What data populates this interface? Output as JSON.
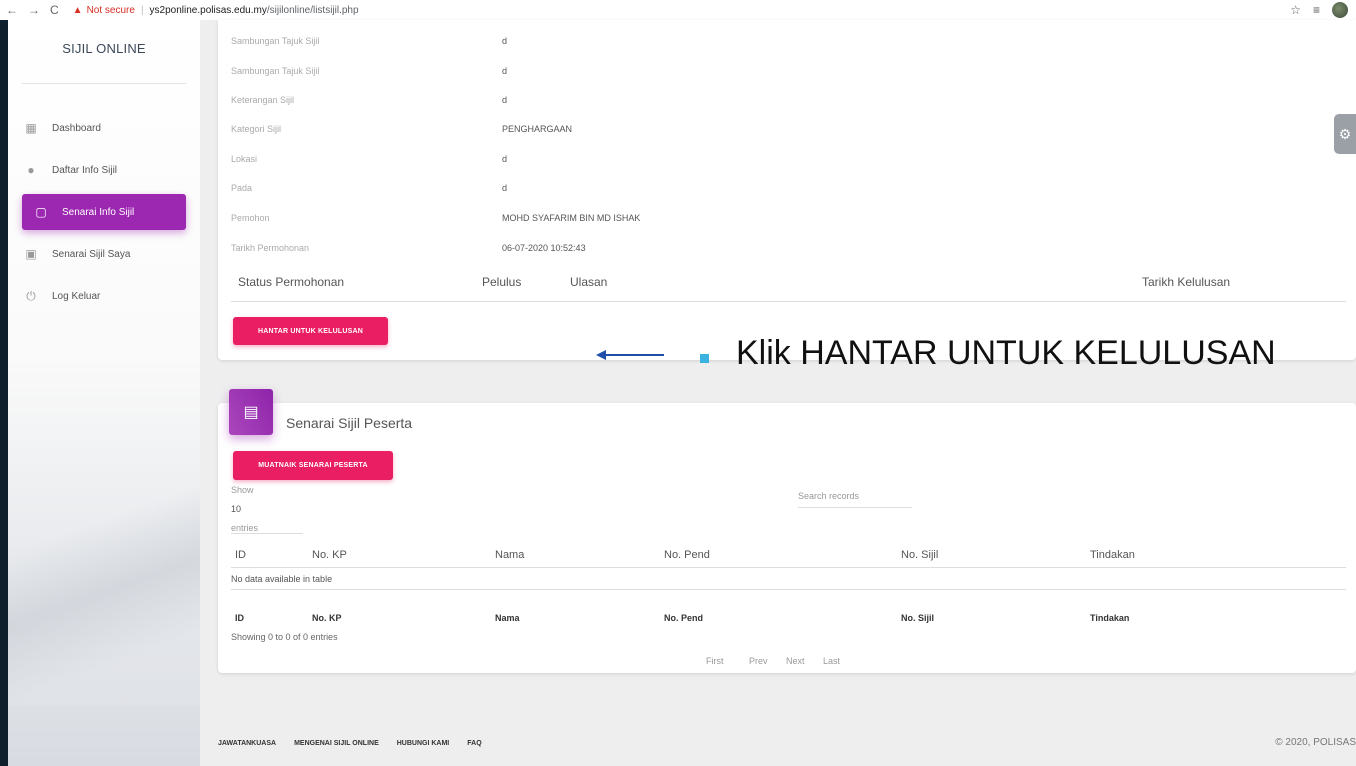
{
  "browser": {
    "not_secure": "Not secure",
    "url_host": "ys2ponline.polisas.edu.my",
    "url_path": "/sijilonline/listsijil.php"
  },
  "sidebar": {
    "title": "SIJIL ONLINE",
    "items": [
      {
        "label": "Dashboard",
        "icon": "dashboard-icon"
      },
      {
        "label": "Daftar Info Sijil",
        "icon": "person-icon"
      },
      {
        "label": "Senarai Info Sijil",
        "icon": "clipboard-icon",
        "active": true
      },
      {
        "label": "Senarai Sijil Saya",
        "icon": "photo-library-icon"
      },
      {
        "label": "Log Keluar",
        "icon": "power-icon"
      }
    ]
  },
  "details": [
    {
      "label": "Sambungan Tajuk Sijil",
      "value": "d"
    },
    {
      "label": "Sambungan Tajuk Sijil",
      "value": "d"
    },
    {
      "label": "Keterangan Sijil",
      "value": "d"
    },
    {
      "label": "Kategori Sijil",
      "value": "PENGHARGAAN"
    },
    {
      "label": "Lokasi",
      "value": "d"
    },
    {
      "label": "Pada",
      "value": "d"
    },
    {
      "label": "Pemohon",
      "value": "MOHD SYAFARIM BIN MD ISHAK"
    },
    {
      "label": "Tarikh Permohonan",
      "value": "06-07-2020 10:52:43"
    }
  ],
  "status_table": {
    "status": "Status Permohonan",
    "pelulus": "Pelulus",
    "ulasan": "Ulasan",
    "tarikh": "Tarikh Kelulusan"
  },
  "submit_button": "HANTAR UNTUK KELULUSAN",
  "annotation": "Klik HANTAR UNTUK KELULUSAN",
  "peserta": {
    "title": "Senarai Sijil Peserta",
    "upload_button": "MUATNAIK SENARAI PESERTA",
    "show": "Show",
    "length": "10",
    "entries": "entries",
    "search_placeholder": "Search records",
    "columns": [
      "ID",
      "No. KP",
      "Nama",
      "No. Pend",
      "No. Sijil",
      "Tindakan"
    ],
    "empty": "No data available in table",
    "info": "Showing 0 to 0 of 0 entries",
    "pager": [
      "First",
      "Prev",
      "Next",
      "Last"
    ]
  },
  "footer": {
    "links": [
      "JAWATANKUASA",
      "MENGENAI SIJIL ONLINE",
      "HUBUNGI KAMI",
      "FAQ"
    ],
    "copyright": "© 2020, POLISAS"
  },
  "colors": {
    "accent": "#9c27b0",
    "button": "#e91e63",
    "bullet": "#3bb3e0",
    "arrow": "#1f4fa8"
  }
}
